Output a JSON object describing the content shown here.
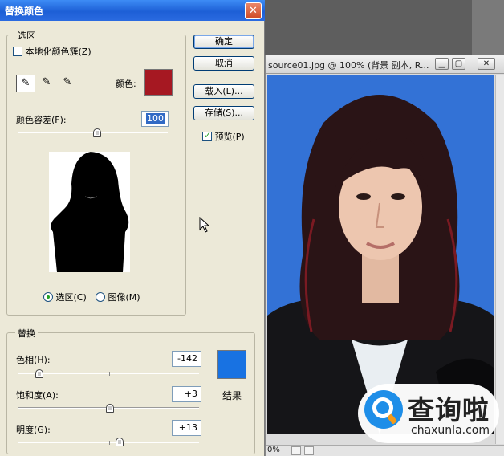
{
  "dialog": {
    "title": "替换颜色",
    "close_glyph": "✕",
    "selection": {
      "group_label": "选区",
      "localized_clusters_label": "本地化颜色簇(Z)",
      "localized_clusters_checked": false,
      "color_label": "颜色:",
      "color_hex": "#a61822",
      "fuzziness_label": "颜色容差(F):",
      "fuzziness_value": "100",
      "fuzziness_level_pct": 53,
      "mode_selection_label": "选区(C)",
      "mode_image_label": "图像(M)",
      "selected_mode": "selection"
    },
    "buttons": {
      "ok": "确定",
      "cancel": "取消",
      "load": "载入(L)...",
      "save": "存储(S)..."
    },
    "preview_label": "预览(P)",
    "preview_checked": true,
    "replacement": {
      "group_label": "替换",
      "hue_label": "色相(H):",
      "hue_value": "-142",
      "hue_level_pct": 12,
      "saturation_label": "饱和度(A):",
      "saturation_value": "+3",
      "saturation_level_pct": 51,
      "lightness_label": "明度(G):",
      "lightness_value": "+13",
      "lightness_level_pct": 56,
      "result_label": "结果",
      "result_hex": "#1872e2"
    }
  },
  "document": {
    "title": "source01.jpg @ 100% (背景 副本, R...",
    "zoom": "0%",
    "background_hex": "#2f6fd3"
  },
  "watermark": {
    "text": "查询啦",
    "sub": "chaxunla.com"
  }
}
